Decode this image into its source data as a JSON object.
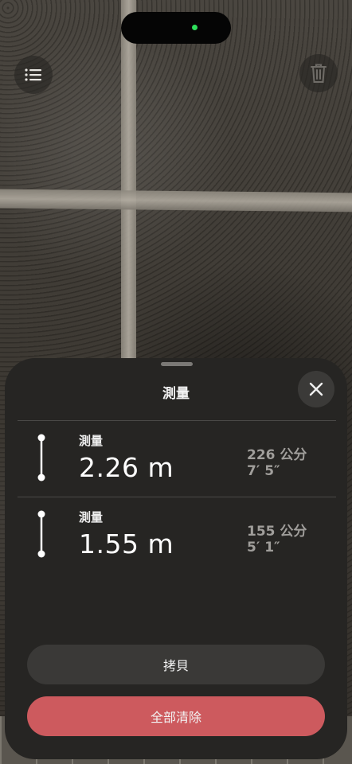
{
  "sheet": {
    "title": "測量"
  },
  "measurements": [
    {
      "label": "測量",
      "value": "2.26 m",
      "metric": "226 公分",
      "imperial": "7′ 5″"
    },
    {
      "label": "測量",
      "value": "1.55 m",
      "metric": "155 公分",
      "imperial": "5′ 1″"
    }
  ],
  "actions": {
    "copy_label": "拷貝",
    "clear_all_label": "全部清除"
  },
  "icons": {
    "list": "list-icon",
    "trash": "trash-icon",
    "close": "close-icon",
    "measure_line": "measure-line-icon"
  },
  "colors": {
    "sheet_bg": "#262523",
    "clear_button": "#cd5a5e",
    "status_dot": "#2ee05b"
  }
}
